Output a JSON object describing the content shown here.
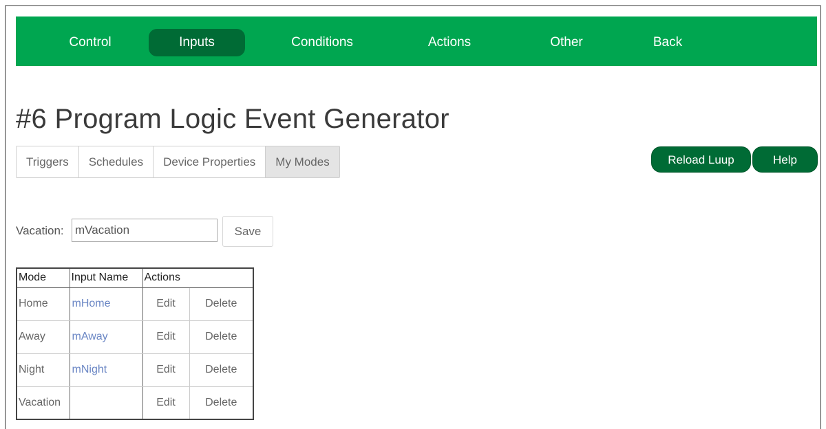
{
  "nav": {
    "items": [
      {
        "label": "Control"
      },
      {
        "label": "Inputs",
        "active": true
      },
      {
        "label": "Conditions"
      },
      {
        "label": "Actions"
      },
      {
        "label": "Other"
      },
      {
        "label": "Back"
      }
    ]
  },
  "page": {
    "title": "#6 Program Logic Event Generator"
  },
  "subtabs": [
    {
      "label": "Triggers"
    },
    {
      "label": "Schedules"
    },
    {
      "label": "Device Properties"
    },
    {
      "label": "My Modes",
      "active": true
    }
  ],
  "buttons": {
    "reload": "Reload Luup",
    "help": "Help"
  },
  "vacation": {
    "label": "Vacation:",
    "value": "mVacation",
    "save": "Save"
  },
  "modes_table": {
    "headers": [
      "Mode",
      "Input Name",
      "Actions"
    ],
    "rows": [
      {
        "mode": "Home",
        "input": "mHome",
        "edit": "Edit",
        "delete": "Delete"
      },
      {
        "mode": "Away",
        "input": "mAway",
        "edit": "Edit",
        "delete": "Delete"
      },
      {
        "mode": "Night",
        "input": "mNight",
        "edit": "Edit",
        "delete": "Delete"
      },
      {
        "mode": "Vacation",
        "input": "",
        "edit": "Edit",
        "delete": "Delete"
      }
    ]
  },
  "colors": {
    "nav_bg": "#00a650",
    "active_green": "#006b35",
    "link_blue": "#6a86c4"
  }
}
